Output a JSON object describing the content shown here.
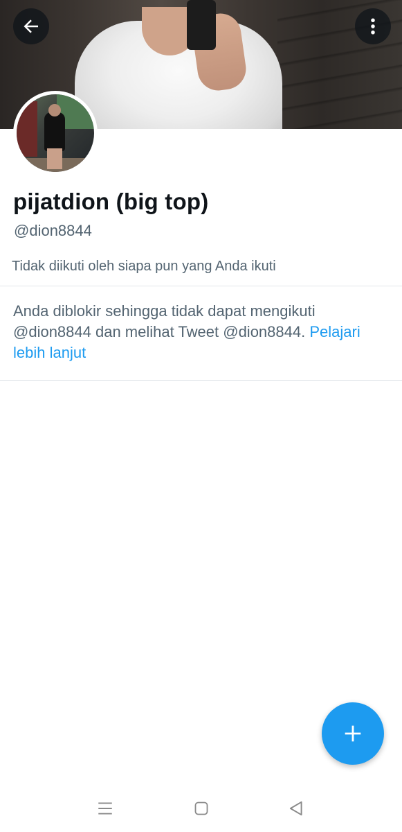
{
  "profile": {
    "display_name": "pijatdion (big top)",
    "handle": "@dion8844",
    "follow_note": "Tidak diikuti oleh siapa pun yang Anda ikuti"
  },
  "blocked_notice": {
    "text": "Anda diblokir sehingga tidak dapat mengikuti @dion8844 dan melihat Tweet @dion8844.",
    "link_label": "Pelajari lebih lanjut"
  },
  "icons": {
    "back": "arrow-left-icon",
    "more": "more-vertical-icon",
    "compose": "plus-icon",
    "nav_menu": "menu-icon",
    "nav_home": "square-home-icon",
    "nav_back": "triangle-back-icon"
  },
  "colors": {
    "accent": "#1d9bf0",
    "text_primary": "#0f1419",
    "text_secondary": "#536471",
    "divider": "#e1e6ea"
  }
}
